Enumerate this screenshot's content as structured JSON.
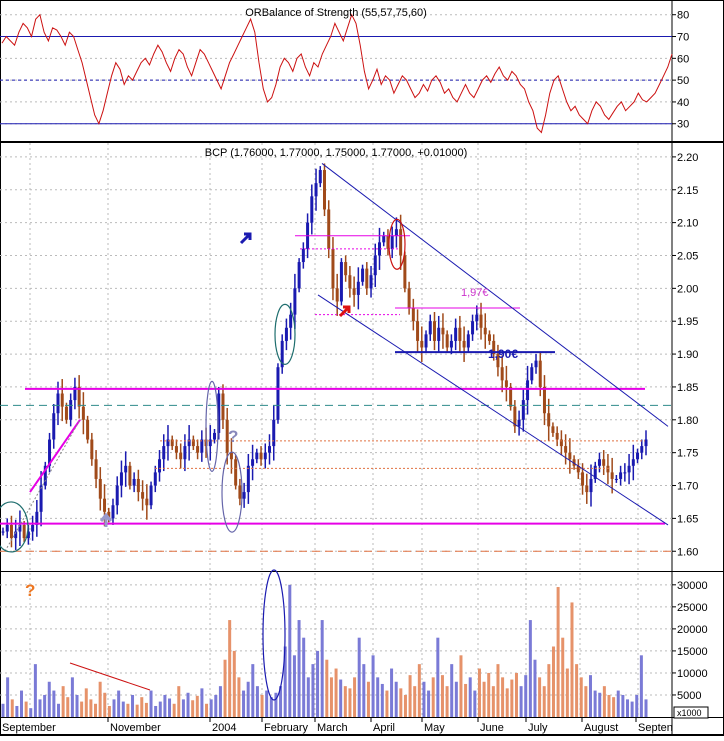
{
  "chart_data": [
    {
      "panel": "rsi",
      "type": "line",
      "title": "ORBalance of Strength (55,57,75,60)",
      "y_ticks": [
        30,
        40,
        50,
        60,
        70,
        80
      ],
      "ylim": [
        23,
        84
      ],
      "reference_lines": [
        70,
        50,
        30
      ],
      "line_color": "#cc1111",
      "series": [
        {
          "values": [
            67,
            70,
            68,
            66,
            72,
            76,
            74,
            70,
            78,
            80,
            72,
            68,
            74,
            73,
            70,
            66,
            72,
            70,
            64,
            58,
            50,
            42,
            34,
            30,
            36,
            44,
            52,
            58,
            55,
            48,
            52,
            50,
            54,
            58,
            60,
            57,
            62,
            66,
            63,
            58,
            54,
            60,
            64,
            62,
            56,
            52,
            58,
            64,
            62,
            58,
            54,
            50,
            46,
            52,
            58,
            62,
            66,
            70,
            74,
            78,
            72,
            58,
            46,
            40,
            42,
            48,
            56,
            60,
            58,
            54,
            60,
            62,
            56,
            52,
            58,
            56,
            62,
            66,
            70,
            76,
            72,
            68,
            74,
            80,
            76,
            66,
            54,
            46,
            50,
            55,
            48,
            52,
            50,
            44,
            48,
            52,
            50,
            46,
            42,
            44,
            48,
            45,
            50,
            52,
            49,
            44,
            46,
            42,
            40,
            44,
            48,
            44,
            42,
            46,
            50,
            52,
            49,
            53,
            56,
            52,
            50,
            54,
            52,
            48,
            46,
            40,
            36,
            28,
            26,
            34,
            44,
            50,
            52,
            46,
            40,
            36,
            38,
            34,
            32,
            30,
            36,
            40,
            38,
            34,
            32,
            35,
            38,
            40,
            36,
            38,
            40,
            44,
            41,
            40,
            42,
            44,
            48,
            52,
            56,
            62
          ]
        }
      ]
    },
    {
      "panel": "price",
      "type": "ohlc",
      "title": "BCP (1.76000, 1.77000, 1.75000, 1.77000, +0.01000)",
      "y_ticks": [
        "1.60",
        "1.65",
        "1.70",
        "1.75",
        "1.80",
        "1.85",
        "1.90",
        "1.95",
        "2.00",
        "2.05",
        "2.10",
        "2.15",
        "2.20"
      ],
      "ylim": [
        1.573,
        2.212
      ],
      "series": [
        {
          "close": [
            1.63,
            1.64,
            1.62,
            1.63,
            1.64,
            1.62,
            1.63,
            1.64,
            1.66,
            1.7,
            1.73,
            1.77,
            1.81,
            1.84,
            1.82,
            1.8,
            1.83,
            1.85,
            1.82,
            1.8,
            1.77,
            1.74,
            1.71,
            1.68,
            1.66,
            1.65,
            1.67,
            1.7,
            1.72,
            1.73,
            1.7,
            1.71,
            1.69,
            1.68,
            1.67,
            1.7,
            1.72,
            1.74,
            1.76,
            1.77,
            1.76,
            1.75,
            1.74,
            1.76,
            1.77,
            1.76,
            1.75,
            1.77,
            1.76,
            1.77,
            1.78,
            1.84,
            1.8,
            1.75,
            1.74,
            1.7,
            1.68,
            1.69,
            1.73,
            1.74,
            1.75,
            1.74,
            1.75,
            1.76,
            1.8,
            1.88,
            1.92,
            1.94,
            1.96,
            2.0,
            2.04,
            2.06,
            2.1,
            2.14,
            2.16,
            2.18,
            2.12,
            2.06,
            2.0,
            1.98,
            2.04,
            2.02,
            2.0,
            1.99,
            2.01,
            2.03,
            2.0,
            2.02,
            2.05,
            2.07,
            2.08,
            2.06,
            2.08,
            2.09,
            2.05,
            2.0,
            1.97,
            1.95,
            1.92,
            1.91,
            1.93,
            1.95,
            1.92,
            1.94,
            1.93,
            1.91,
            1.92,
            1.94,
            1.92,
            1.91,
            1.93,
            1.95,
            1.96,
            1.94,
            1.93,
            1.92,
            1.9,
            1.88,
            1.86,
            1.85,
            1.82,
            1.79,
            1.8,
            1.83,
            1.86,
            1.88,
            1.89,
            1.85,
            1.81,
            1.79,
            1.78,
            1.77,
            1.76,
            1.75,
            1.74,
            1.73,
            1.72,
            1.7,
            1.69,
            1.71,
            1.73,
            1.74,
            1.73,
            1.72,
            1.71,
            1.71,
            1.72,
            1.72,
            1.73,
            1.74,
            1.75,
            1.76,
            1.77
          ]
        }
      ],
      "annotations": [
        "1,97€",
        "1,90€",
        "?"
      ]
    },
    {
      "panel": "volume",
      "type": "bar",
      "y_ticks": [
        5000,
        10000,
        15000,
        20000,
        25000,
        30000
      ],
      "ylim": [
        0,
        32000
      ],
      "unit_label": "x1000",
      "annotations": [
        "?"
      ],
      "series": [
        {
          "values": [
            3000,
            9000,
            4000,
            2500,
            6000,
            3500,
            2000,
            12000,
            4000,
            5000,
            8000,
            6000,
            3000,
            7000,
            4500,
            9000,
            5000,
            3500,
            6500,
            4000,
            3000,
            8000,
            5500,
            2500,
            4000,
            6000,
            3500,
            3000,
            5000,
            2800,
            4500,
            3200,
            6000,
            2500,
            3500,
            5000,
            4200,
            3000,
            7000,
            4000,
            5500,
            3800,
            4800,
            6500,
            3000,
            4000,
            5000,
            7000,
            13000,
            22000,
            15000,
            9000,
            6000,
            8000,
            12000,
            7000,
            5000,
            6000,
            4500,
            5500,
            7000,
            16000,
            30000,
            14000,
            22000,
            18000,
            9000,
            12000,
            15000,
            22000,
            13000,
            9000,
            11000,
            8500,
            7000,
            6500,
            9000,
            18000,
            12000,
            8000,
            14000,
            9000,
            7500,
            6000,
            11000,
            8000,
            6500,
            5000,
            9500,
            7000,
            12000,
            8000,
            6000,
            9000,
            18000,
            9500,
            7000,
            12000,
            8000,
            14000,
            7500,
            9000,
            6000,
            11000,
            8000,
            10000,
            7000,
            12000,
            9000,
            6500,
            8500,
            10000,
            7000,
            9500,
            22000,
            13000,
            9000,
            7000,
            12000,
            16000,
            29500,
            18000,
            11000,
            26000,
            12000,
            9000,
            7000,
            9500,
            6000,
            5500,
            7000,
            5000,
            4500,
            6000,
            5000,
            4000,
            3500,
            5000,
            14000,
            4000
          ]
        }
      ]
    },
    {
      "panel": "date-axis",
      "type": "axis",
      "x_labels": [
        "September",
        "November",
        "2004",
        "February",
        "March",
        "April",
        "May",
        "June",
        "July",
        "August",
        "Septen"
      ]
    }
  ]
}
